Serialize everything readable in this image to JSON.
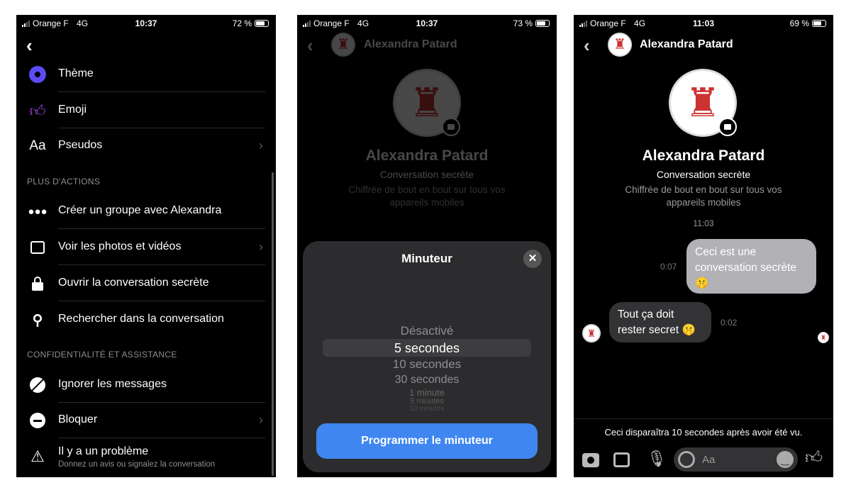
{
  "panels": [
    {
      "status": {
        "carrier": "Orange F",
        "network": "4G",
        "time": "10:37",
        "battery": "72 %"
      },
      "items_top": [
        {
          "label": "Thème",
          "icon": "theme-circle-icon"
        },
        {
          "label": "Emoji",
          "icon": "thumbs-up-icon"
        },
        {
          "label": "Pseudos",
          "icon": "text-aa-icon",
          "chevron": true
        }
      ],
      "section1": "PLUS D'ACTIONS",
      "items_actions": [
        {
          "label": "Créer un groupe avec Alexandra",
          "icon": "group-icon"
        },
        {
          "label": "Voir les photos et vidéos",
          "icon": "photo-icon",
          "chevron": true
        },
        {
          "label": "Ouvrir la conversation secrète",
          "icon": "lock-icon"
        },
        {
          "label": "Rechercher dans la conversation",
          "icon": "search-icon"
        }
      ],
      "section2": "CONFIDENTIALITÉ ET ASSISTANCE",
      "items_privacy": [
        {
          "label": "Ignorer les messages",
          "icon": "ignore-icon"
        },
        {
          "label": "Bloquer",
          "icon": "block-icon",
          "chevron": true
        },
        {
          "label": "Il y a un problème",
          "sub": "Donnez un avis ou signalez la conversation",
          "icon": "warning-icon"
        }
      ],
      "icon_text": "Aa",
      "theme_color": "#5b4cf5",
      "emoji_color": "#a444f0"
    },
    {
      "status": {
        "carrier": "Orange F",
        "network": "4G",
        "time": "10:37",
        "battery": "73 %"
      },
      "header_name": "Alexandra Patard",
      "name": "Alexandra Patard",
      "subtitle": "Conversation secrète",
      "description": "Chiffrée de bout en bout sur tous vos appareils mobiles",
      "sheet": {
        "title": "Minuteur",
        "options": [
          "Désactivé",
          "5 secondes",
          "10 secondes",
          "30 secondes",
          "1 minute",
          "5 minutes",
          "10 minutes"
        ],
        "selected": "5 secondes",
        "button": "Programmer le minuteur",
        "button_color": "#3f86f0"
      }
    },
    {
      "status": {
        "carrier": "Orange F",
        "network": "4G",
        "time": "11:03",
        "battery": "69 %"
      },
      "header_name": "Alexandra Patard",
      "name": "Alexandra Patard",
      "subtitle": "Conversation secrète",
      "description": "Chiffrée de bout en bout sur tous vos appareils mobiles",
      "timestamp": "11:03",
      "messages": [
        {
          "from": "me",
          "text": "Ceci est une conversation secrète 🤫",
          "timer": "0:07"
        },
        {
          "from": "them",
          "text": "Tout ça doit rester secret 🤫",
          "timer": "0:02"
        }
      ],
      "notice": "Ceci disparaîtra 10 secondes après avoir été vu.",
      "input_placeholder": "Aa"
    }
  ]
}
